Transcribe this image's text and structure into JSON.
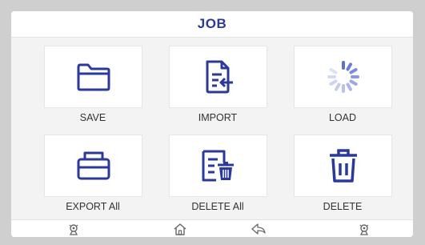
{
  "header": {
    "title": "JOB"
  },
  "tiles": [
    {
      "label": "SAVE",
      "icon": "folder-icon"
    },
    {
      "label": "IMPORT",
      "icon": "import-document-icon"
    },
    {
      "label": "LOAD",
      "icon": "loading-spinner-icon"
    },
    {
      "label": "EXPORT All",
      "icon": "printer-icon"
    },
    {
      "label": "DELETE All",
      "icon": "delete-all-document-icon"
    },
    {
      "label": "DELETE",
      "icon": "trash-icon"
    }
  ],
  "bottom_nav": [
    {
      "icon": "robot-left-icon"
    },
    {
      "icon": "home-icon"
    },
    {
      "icon": "back-icon"
    },
    {
      "icon": "robot-right-icon"
    }
  ],
  "colors": {
    "accent": "#2b3a9a",
    "spinner": "#5b6fd6"
  }
}
